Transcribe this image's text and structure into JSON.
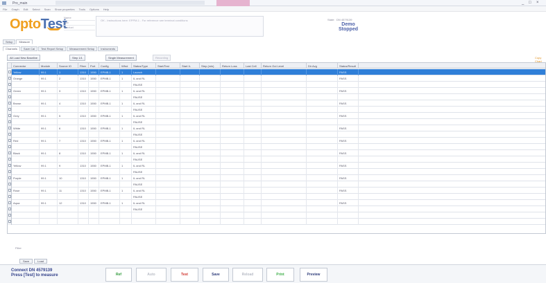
{
  "window": {
    "title": "Pro_main",
    "controls": [
      "_",
      "□",
      "×"
    ]
  },
  "menu": {
    "items": [
      "File",
      "Graph",
      "Edit",
      "Select",
      "Scan",
      "Show properties",
      "Tools",
      "Options",
      "Help"
    ]
  },
  "logo": {
    "part1": "Opto",
    "part2": "Test"
  },
  "header": {
    "fields": [
      "Name",
      "Lab",
      "Product"
    ],
    "note": "OK - Instructions here: EPPM-1 - For reference see terminal conditions",
    "state_label": "State:",
    "state_value": "DN 4579139",
    "mode_line1": "Demo",
    "mode_line2": "Stopped"
  },
  "tabs_top": [
    "Setup",
    "Measure"
  ],
  "tabs_sub": [
    "Channels",
    "Save Cal",
    "Test Report Setup",
    "Measurement Setup",
    "Instruments"
  ],
  "toolbar": {
    "buttons": [
      "All Load New Baseline",
      "Step 1/1",
      "Single Measurement",
      "Recording"
    ],
    "right_link": "Copy Chart"
  },
  "grid": {
    "columns": [
      "Connector",
      "Module",
      "Source IO",
      "Fiber",
      "Port",
      "Config",
      "Wfnd",
      "Status/Type",
      "Start/Test",
      "Start IL",
      "Step (min)",
      "Return Loss",
      "Last Cell",
      "Return Out Level",
      "Dir Avg",
      "Status/Result",
      ""
    ],
    "rows": [
      {
        "selected": true,
        "cells": [
          "Yellow",
          "99.1",
          "1",
          "1310",
          "1550",
          "EPMB-1",
          "1",
          "Launch",
          "",
          "",
          "",
          "",
          "",
          "",
          "",
          "PASS",
          ""
        ]
      },
      {
        "selected": false,
        "cells": [
          "Orange",
          "99.1",
          "2",
          "1310",
          "1550",
          "EPMB-1",
          "1",
          "IL and RL",
          "",
          "",
          "",
          "",
          "",
          "",
          "",
          "PASS",
          ""
        ]
      },
      {
        "selected": false,
        "cells": [
          "",
          "",
          "",
          "",
          "",
          "",
          "",
          "PAUSE",
          "",
          "",
          "",
          "",
          "",
          "",
          "",
          "",
          ""
        ]
      },
      {
        "selected": false,
        "cells": [
          "Green",
          "99.1",
          "3",
          "1310",
          "1550",
          "EPMB-1",
          "1",
          "IL and RL",
          "",
          "",
          "",
          "",
          "",
          "",
          "",
          "PASS",
          ""
        ]
      },
      {
        "selected": false,
        "cells": [
          "",
          "",
          "",
          "",
          "",
          "",
          "",
          "PAUSE",
          "",
          "",
          "",
          "",
          "",
          "",
          "",
          "",
          ""
        ]
      },
      {
        "selected": false,
        "cells": [
          "Brown",
          "99.1",
          "4",
          "1310",
          "1550",
          "EPMB-1",
          "1",
          "IL and RL",
          "",
          "",
          "",
          "",
          "",
          "",
          "",
          "PASS",
          ""
        ]
      },
      {
        "selected": false,
        "cells": [
          "",
          "",
          "",
          "",
          "",
          "",
          "",
          "PAUSE",
          "",
          "",
          "",
          "",
          "",
          "",
          "",
          "",
          ""
        ]
      },
      {
        "selected": false,
        "cells": [
          "Grey",
          "99.1",
          "5",
          "1310",
          "1550",
          "EPMB-1",
          "1",
          "IL and RL",
          "",
          "",
          "",
          "",
          "",
          "",
          "",
          "PASS",
          ""
        ]
      },
      {
        "selected": false,
        "cells": [
          "",
          "",
          "",
          "",
          "",
          "",
          "",
          "PAUSE",
          "",
          "",
          "",
          "",
          "",
          "",
          "",
          "",
          ""
        ]
      },
      {
        "selected": false,
        "cells": [
          "White",
          "99.1",
          "6",
          "1310",
          "1550",
          "EPMB-1",
          "1",
          "IL and RL",
          "",
          "",
          "",
          "",
          "",
          "",
          "",
          "PASS",
          ""
        ]
      },
      {
        "selected": false,
        "cells": [
          "",
          "",
          "",
          "",
          "",
          "",
          "",
          "PAUSE",
          "",
          "",
          "",
          "",
          "",
          "",
          "",
          "",
          ""
        ]
      },
      {
        "selected": false,
        "cells": [
          "Red",
          "99.1",
          "7",
          "1310",
          "1550",
          "EPMB-1",
          "1",
          "IL and RL",
          "",
          "",
          "",
          "",
          "",
          "",
          "",
          "PASS",
          ""
        ]
      },
      {
        "selected": false,
        "cells": [
          "",
          "",
          "",
          "",
          "",
          "",
          "",
          "PAUSE",
          "",
          "",
          "",
          "",
          "",
          "",
          "",
          "",
          ""
        ]
      },
      {
        "selected": false,
        "cells": [
          "Black",
          "99.1",
          "8",
          "1310",
          "1550",
          "EPMB-1",
          "1",
          "IL and RL",
          "",
          "",
          "",
          "",
          "",
          "",
          "",
          "PASS",
          ""
        ]
      },
      {
        "selected": false,
        "cells": [
          "",
          "",
          "",
          "",
          "",
          "",
          "",
          "PAUSE",
          "",
          "",
          "",
          "",
          "",
          "",
          "",
          "",
          ""
        ]
      },
      {
        "selected": false,
        "cells": [
          "Yellow",
          "99.1",
          "9",
          "1310",
          "1550",
          "EPMB-1",
          "1",
          "IL and RL",
          "",
          "",
          "",
          "",
          "",
          "",
          "",
          "PASS",
          ""
        ]
      },
      {
        "selected": false,
        "cells": [
          "",
          "",
          "",
          "",
          "",
          "",
          "",
          "PAUSE",
          "",
          "",
          "",
          "",
          "",
          "",
          "",
          "",
          ""
        ]
      },
      {
        "selected": false,
        "cells": [
          "Purple",
          "99.1",
          "10",
          "1310",
          "1550",
          "EPMB-1",
          "1",
          "IL and RL",
          "",
          "",
          "",
          "",
          "",
          "",
          "",
          "PASS",
          ""
        ]
      },
      {
        "selected": false,
        "cells": [
          "",
          "",
          "",
          "",
          "",
          "",
          "",
          "PAUSE",
          "",
          "",
          "",
          "",
          "",
          "",
          "",
          "",
          ""
        ]
      },
      {
        "selected": false,
        "cells": [
          "Rose",
          "99.1",
          "11",
          "1310",
          "1550",
          "EPMB-1",
          "1",
          "IL and RL",
          "",
          "",
          "",
          "",
          "",
          "",
          "",
          "PASS",
          ""
        ]
      },
      {
        "selected": false,
        "cells": [
          "",
          "",
          "",
          "",
          "",
          "",
          "",
          "PAUSE",
          "",
          "",
          "",
          "",
          "",
          "",
          "",
          "",
          ""
        ]
      },
      {
        "selected": false,
        "cells": [
          "Aqua",
          "99.1",
          "12",
          "1310",
          "1550",
          "EPMB-1",
          "1",
          "IL and RL",
          "",
          "",
          "",
          "",
          "",
          "",
          "",
          "PASS",
          ""
        ]
      },
      {
        "selected": false,
        "cells": [
          "",
          "",
          "",
          "",
          "",
          "",
          "",
          "PAUSE",
          "",
          "",
          "",
          "",
          "",
          "",
          "",
          "",
          ""
        ]
      },
      {
        "selected": false,
        "cells": [
          "",
          "",
          "",
          "",
          "",
          "",
          "",
          "",
          "",
          "",
          "",
          "",
          "",
          "",
          "",
          "",
          ""
        ]
      },
      {
        "selected": false,
        "cells": [
          "",
          "",
          "",
          "",
          "",
          "",
          "",
          "",
          "",
          "",
          "",
          "",
          "",
          "",
          "",
          "",
          ""
        ]
      }
    ]
  },
  "filter_label": "Filter",
  "bottom_tabs": [
    "Save",
    "Load"
  ],
  "status": {
    "line1": "Connect DN 4579139",
    "line2": "Press [Test] to measure"
  },
  "actions": [
    {
      "label": "Ref",
      "color": "#2f9a3a"
    },
    {
      "label": "Auto",
      "color": "#b8bcc6"
    },
    {
      "label": "Test",
      "color": "#d0342c"
    },
    {
      "label": "Save",
      "color": "#2e3c7a"
    },
    {
      "label": "Reload",
      "color": "#b8bcc6"
    },
    {
      "label": "Print",
      "color": "#3fb04a"
    },
    {
      "label": "Preview",
      "color": "#2e3c7a"
    }
  ]
}
